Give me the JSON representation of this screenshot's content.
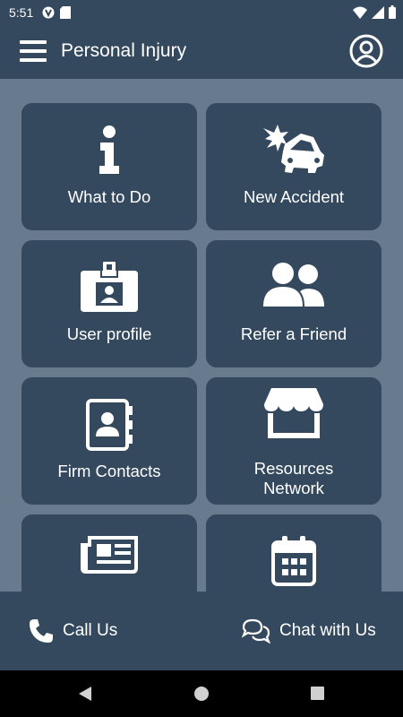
{
  "status_bar": {
    "time": "5:51",
    "left_icons": [
      "app-icon",
      "sd-card-icon"
    ],
    "right_icons": [
      "wifi-icon",
      "signal-icon",
      "battery-icon"
    ]
  },
  "app_bar": {
    "title": "Personal Injury",
    "menu_icon": "hamburger-menu-icon",
    "profile_icon": "account-circle-icon"
  },
  "tiles": [
    {
      "label": "What to Do",
      "icon": "info-icon"
    },
    {
      "label": "New Accident",
      "icon": "car-crash-icon"
    },
    {
      "label": "User profile",
      "icon": "id-badge-icon"
    },
    {
      "label": "Refer a Friend",
      "icon": "users-icon"
    },
    {
      "label": "Firm Contacts",
      "icon": "address-book-icon"
    },
    {
      "label": "Resources\nNetwork",
      "icon": "store-icon"
    },
    {
      "label": "",
      "icon": "newspaper-icon"
    },
    {
      "label": "",
      "icon": "calendar-icon"
    }
  ],
  "bottom_bar": {
    "call_label": "Call Us",
    "call_icon": "phone-icon",
    "chat_label": "Chat with Us",
    "chat_icon": "chat-bubbles-icon"
  },
  "nav_bar": {
    "icons": [
      "back-triangle-icon",
      "home-circle-icon",
      "recents-square-icon"
    ]
  },
  "colors": {
    "primary": "#34495e",
    "background": "#687a8d",
    "text": "#ffffff"
  }
}
